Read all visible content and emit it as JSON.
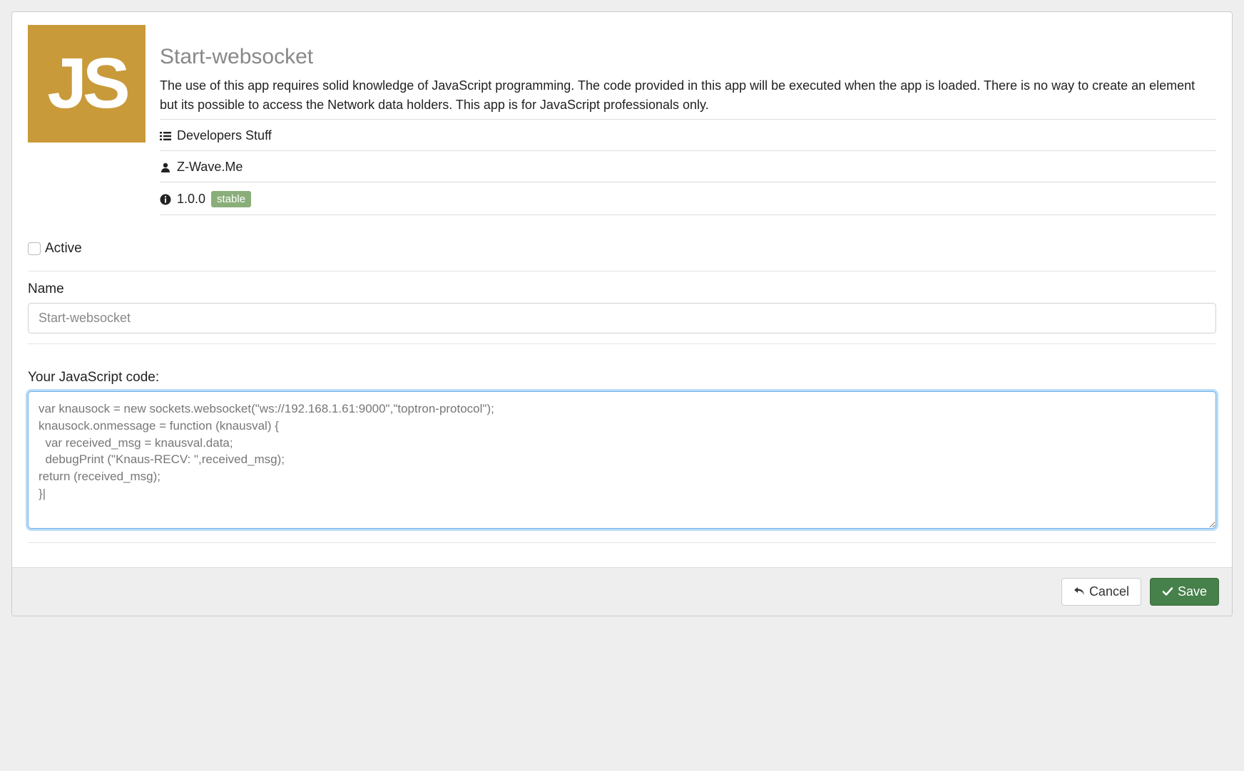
{
  "app": {
    "iconText": "JS",
    "title": "Start-websocket",
    "description": "The use of this app requires solid knowledge of JavaScript programming. The code provided in this app will be executed when the app is loaded. There is no way to create an element but its possible to access the Network data holders. This app is for JavaScript professionals only.",
    "category": "Developers Stuff",
    "author": "Z-Wave.Me",
    "version": "1.0.0",
    "stability": "stable"
  },
  "form": {
    "activeLabel": "Active",
    "nameLabel": "Name",
    "nameValue": "Start-websocket",
    "codeLabel": "Your JavaScript code:",
    "codeValue": "var knausock = new sockets.websocket(\"ws://192.168.1.61:9000\",\"toptron-protocol\");\nknausock.onmessage = function (knausval) {\n  var received_msg = knausval.data;\n  debugPrint (\"Knaus-RECV: \",received_msg);\nreturn (received_msg);\n}|"
  },
  "buttons": {
    "cancel": "Cancel",
    "save": "Save"
  }
}
